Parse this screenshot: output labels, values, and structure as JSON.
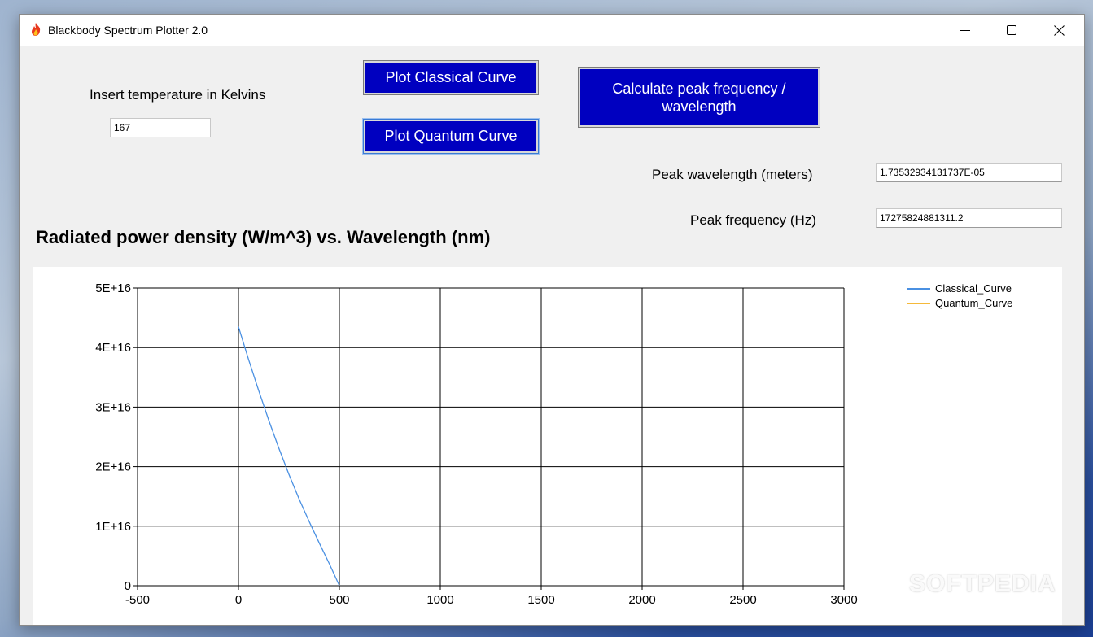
{
  "window": {
    "title": "Blackbody Spectrum Plotter 2.0"
  },
  "controls": {
    "temp_label": "Insert temperature in Kelvins",
    "temp_value": "167",
    "plot_classical": "Plot Classical Curve",
    "plot_quantum": "Plot Quantum Curve",
    "calc_peak": "Calculate peak frequency / wavelength",
    "peak_wavelength_label": "Peak wavelength (meters)",
    "peak_wavelength_value": "1.73532934131737E-05",
    "peak_frequency_label": "Peak frequency (Hz)",
    "peak_frequency_value": "17275824881311.2"
  },
  "watermark": "SOFTPEDIA",
  "colors": {
    "button_bg": "#0000c0",
    "classical": "#4a90e2",
    "quantum": "#f5b93a"
  },
  "chart_data": {
    "type": "line",
    "title": "Radiated power density (W/m^3) vs. Wavelength (nm)",
    "xlabel": "",
    "ylabel": "",
    "xlim": [
      -500,
      3000
    ],
    "ylim": [
      0,
      50000000000000000
    ],
    "x_ticks": [
      "-500",
      "0",
      "500",
      "1000",
      "1500",
      "2000",
      "2500",
      "3000"
    ],
    "y_ticks": [
      "0",
      "1E+16",
      "2E+16",
      "3E+16",
      "4E+16",
      "5E+16"
    ],
    "grid": true,
    "legend_placement": "top-right",
    "series": [
      {
        "name": "Classical_Curve",
        "x": [
          0,
          50,
          100,
          150,
          200,
          250,
          300,
          350,
          400,
          450,
          500
        ],
        "y": [
          43500000000000000,
          38000000000000000,
          32800000000000000,
          27800000000000000,
          23100000000000000,
          18700000000000000,
          14600000000000000,
          10800000000000000,
          7200000000000000,
          3700000000000000,
          0
        ]
      },
      {
        "name": "Quantum_Curve",
        "x": [],
        "y": []
      }
    ]
  }
}
